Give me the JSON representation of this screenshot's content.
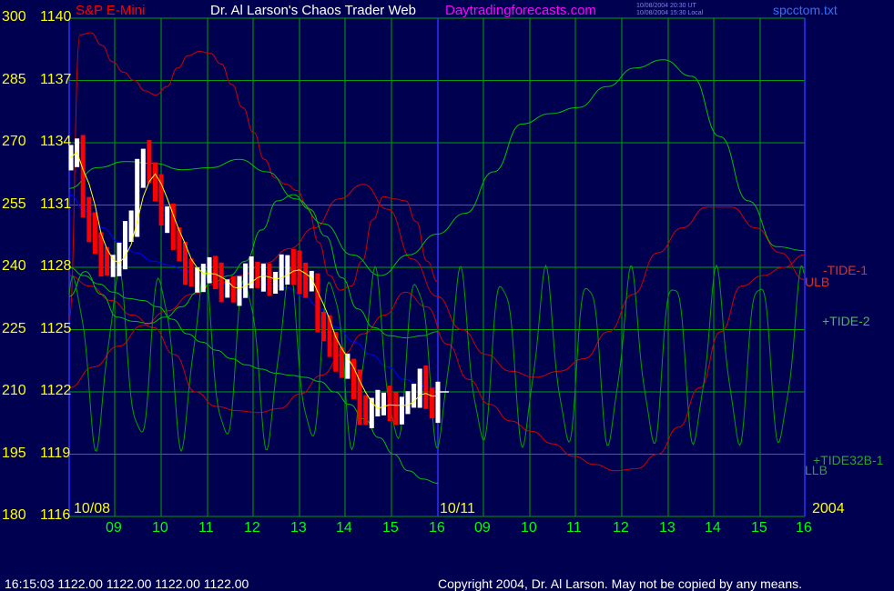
{
  "header": {
    "instrument": "S&P E-Mini",
    "title": "Dr. Al Larson's Chaos Trader Web",
    "site": "Daytradingforecasts.com",
    "stamp_line1": "10/08/2004 20:30 UT",
    "stamp_line2": "10/08/2004 15:30 Local",
    "file": "spcctom.txt"
  },
  "footer": {
    "quote": "16:15:03   1122.00  1122.00  1122.00  1122.00",
    "copyright": "Copyright 2004, Dr. Al Larson. May not be copied by any means."
  },
  "colors": {
    "background": "#000050",
    "grid": "#00a000",
    "price_up": "#ffffff",
    "price_down": "#ff0000",
    "moving_average": "#ffff00",
    "blue_line": "#0000ff",
    "red_curves": "#d00000",
    "green_curves": "#00c000",
    "axis_text": "#ffff00",
    "hour_text": "#00ff00"
  },
  "chart_data": {
    "type": "line",
    "y_left_labels": [
      "300",
      "285",
      "270",
      "255",
      "240",
      "225",
      "210",
      "195",
      "180"
    ],
    "y_price_labels": [
      "1140",
      "1137",
      "1134",
      "1131",
      "1128",
      "1125",
      "1122",
      "1119",
      "1116"
    ],
    "ylim_price": [
      1116,
      1140
    ],
    "hour_labels": [
      "09",
      "10",
      "11",
      "12",
      "13",
      "14",
      "15",
      "16",
      "09",
      "10",
      "11",
      "12",
      "13",
      "14",
      "15",
      "16"
    ],
    "date_labels": [
      "10/08",
      "10/11",
      "2004"
    ],
    "grid": true,
    "series": [
      {
        "name": "-TIDE-1"
      },
      {
        "name": "ULB"
      },
      {
        "name": "+TIDE-2"
      },
      {
        "name": "+TIDE32B-1"
      },
      {
        "name": "LLB"
      }
    ],
    "price": {
      "close": [
        1133.3,
        1133.8,
        1131.0,
        1130.0,
        1129.2,
        1128.3,
        1128.0,
        1128.0,
        1128.5,
        1129.6,
        1130.3,
        1132.4,
        1133.3,
        1132.5,
        1131.8,
        1130.5,
        1130.5,
        1129.3,
        1128.8,
        1127.9,
        1127.6,
        1127.6,
        1127.7,
        1127.9,
        1127.5,
        1127.0,
        1127.0,
        1126.7,
        1127.2,
        1127.5,
        1127.7,
        1127.6,
        1127.6,
        1127.2,
        1127.3,
        1127.9,
        1128.1,
        1128.0,
        1127.5,
        1127.2,
        1127.2,
        1125.4,
        1125.0,
        1124.4,
        1123.8,
        1123.2,
        1123.2,
        1122.5,
        1121.2,
        1121.0,
        1121.3,
        1121.3,
        1121.6,
        1121.3,
        1121.2,
        1121.3,
        1121.6,
        1122.0,
        1122.5,
        1121.6,
        1121.1,
        1122.0
      ],
      "last": 1122.0
    },
    "tide_curves": [
      {
        "color": "red",
        "y": [
          1125.5,
          1139.2,
          1139.3,
          1138.7,
          1137.9,
          1137.4,
          1137.0,
          1136.5,
          1136.3,
          1136.7,
          1137.6,
          1138.2,
          1138.4,
          1138.3,
          1137.8,
          1136.8,
          1135.7,
          1134.5,
          1133.2,
          1132.3,
          1132.0,
          1131.7,
          1130.9,
          1129.2,
          1127.6,
          1126.9,
          1127.1,
          1128.3,
          1130.3,
          1131.4,
          1131.3,
          1131.2,
          1130.2,
          1128.3,
          1127.3
        ]
      },
      {
        "color": "red",
        "y": [
          1122.2,
          1123.2,
          1124.2,
          1125.2,
          1125.9,
          1126.7,
          1127.2,
          1127.6,
          1128.2,
          1128.9,
          1129.9,
          1131.3,
          1132.0,
          1130.8,
          1128.4,
          1126.6,
          1125.0,
          1123.8,
          1123.0,
          1122.7,
          1123.0,
          1123.6,
          1124.9,
          1126.7,
          1128.7,
          1129.9,
          1130.9,
          1130.9,
          1129.9,
          1128.7,
          1127.4
        ]
      },
      {
        "color": "red",
        "y": [
          1127.6,
          1127.1,
          1126.4,
          1125.7,
          1125.1,
          1123.8,
          1122.0,
          1121.3,
          1121.1,
          1121.0,
          1121.2,
          1121.9,
          1122.8,
          1123.8,
          1124.8,
          1125.7,
          1126.8,
          1126.1,
          1124.3,
          1122.6,
          1121.4,
          1120.6,
          1120.1,
          1119.5,
          1118.9,
          1118.5,
          1118.2,
          1118.3,
          1119.0,
          1120.3,
          1122.2,
          1124.9,
          1127.1,
          1127.6,
          1128.0,
          1128.6
        ]
      },
      {
        "color": "green",
        "y": [
          1126.6,
          1127.8,
          1126.7,
          1125.6,
          1125.4,
          1125.3,
          1125.6,
          1126.1,
          1126.8,
          1127.3,
          1127.6,
          1128.3,
          1129.8,
          1131.2,
          1131.5,
          1130.8,
          1129.5,
          1127.5,
          1126.0,
          1125.1,
          1124.7,
          1124.6,
          1124.7,
          1124.9
        ]
      },
      {
        "color": "green",
        "y": [
          1128.0,
          1127.6,
          1127.2,
          1126.8,
          1126.5,
          1126.4,
          1126.1,
          1125.5,
          1124.8,
          1124.4,
          1124.0,
          1123.6,
          1123.3,
          1123.1,
          1122.9,
          1122.8,
          1122.7,
          1122.5,
          1122.0,
          1121.4,
          1120.7,
          1119.8,
          1119.0,
          1118.2,
          1117.8,
          1117.6
        ]
      },
      {
        "color": "green",
        "y": [
          1131.8,
          1132.8,
          1133.1,
          1133.0,
          1132.7,
          1132.8,
          1133.2,
          1132.6,
          1131.3,
          1130.1,
          1128.6,
          1127.6,
          1128.6,
          1129.6,
          1130.6,
          1132.6,
          1134.9,
          1135.4,
          1135.7,
          1136.7,
          1137.6,
          1138.0,
          1137.2,
          1134.3,
          1131.2,
          1129.0,
          1128.8
        ]
      },
      {
        "color": "blue",
        "y": [
          1131.5,
          1130.7,
          1129.9,
          1129.2,
          1128.7,
          1128.3,
          1128.1,
          1127.8,
          1127.5,
          1127.2,
          1127.2,
          1127.2,
          1127.2,
          1127.0,
          1126.6,
          1126.0,
          1125.1,
          1124.4,
          1123.8,
          1123.2,
          1122.6,
          1122.3,
          1122.2
        ]
      }
    ],
    "oscillators": [
      {
        "period_hours": 0.93,
        "amplitude": 3.9,
        "center": 1123.6,
        "phase": 0.7
      },
      {
        "period_hours": 0.37,
        "amplitude": 0.6,
        "center": 0,
        "phase": 1.3
      }
    ]
  }
}
